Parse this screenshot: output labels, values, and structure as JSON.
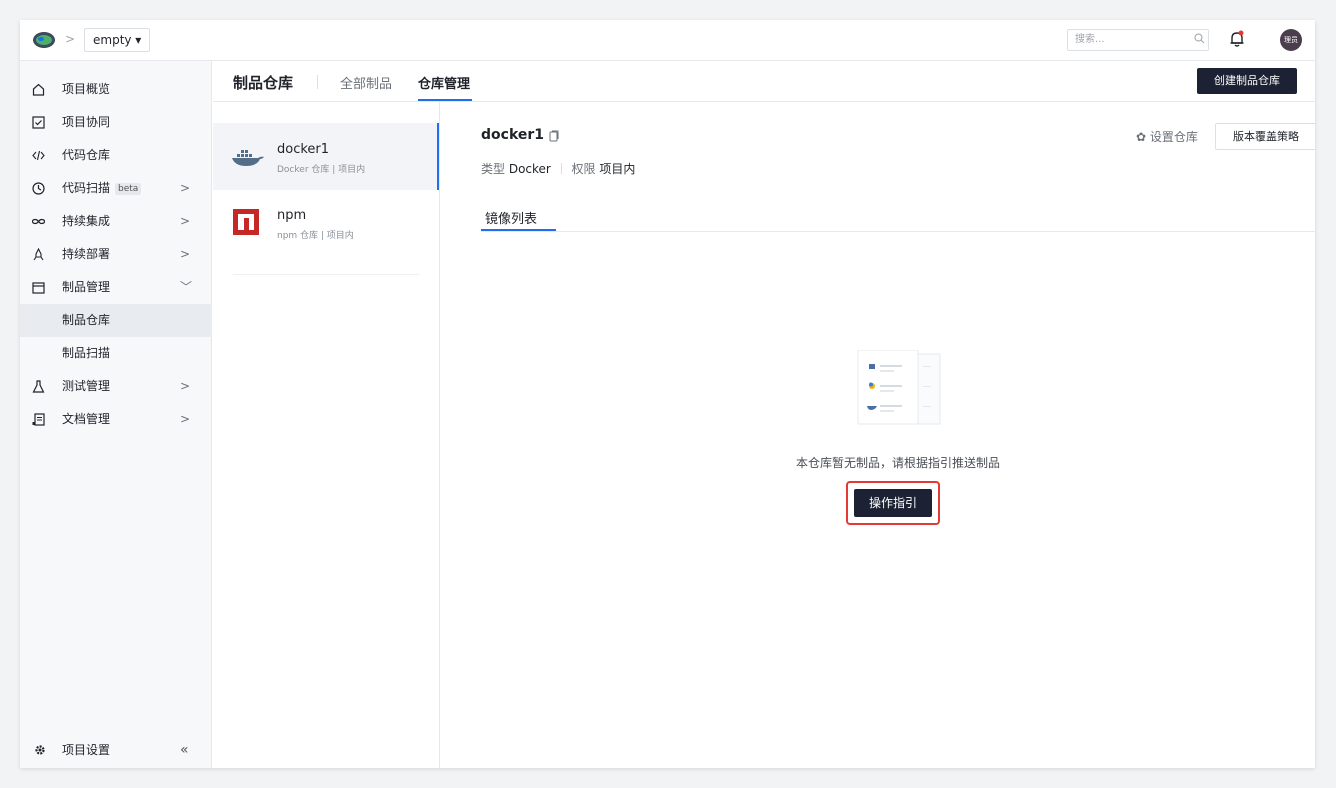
{
  "header": {
    "project_name": "empty ▾",
    "breadcrumb_separator": ">",
    "search_placeholder": "搜索...",
    "avatar_text": "理员"
  },
  "sidebar": {
    "items": [
      {
        "label": "项目概览",
        "icon": "home-icon"
      },
      {
        "label": "项目协同",
        "icon": "check-square-icon"
      },
      {
        "label": "代码仓库",
        "icon": "code-icon"
      },
      {
        "label": "代码扫描",
        "icon": "scan-icon",
        "badge": "beta",
        "arrow": ">"
      },
      {
        "label": "持续集成",
        "icon": "infinity-icon",
        "arrow": ">"
      },
      {
        "label": "持续部署",
        "icon": "rocket-icon",
        "arrow": ">"
      },
      {
        "label": "制品管理",
        "icon": "box-icon",
        "arrow": "﹀"
      },
      {
        "label": "制品仓库"
      },
      {
        "label": "制品扫描"
      },
      {
        "label": "测试管理",
        "icon": "flask-icon",
        "arrow": ">"
      },
      {
        "label": "文档管理",
        "icon": "doc-icon",
        "arrow": ">"
      }
    ],
    "footer_label": "项目设置",
    "collapse_glyph": "«"
  },
  "content_header": {
    "title": "制品仓库",
    "tab_all": "全部制品",
    "tab_manage": "仓库管理",
    "create_button": "创建制品仓库"
  },
  "repos": [
    {
      "name": "docker1",
      "meta": "Docker 仓库 | 项目内"
    },
    {
      "name": "npm",
      "meta": "npm 仓库 | 项目内"
    }
  ],
  "detail": {
    "title": "docker1",
    "type_label": "类型",
    "type_value": "Docker",
    "perm_label": "权限",
    "perm_value": "项目内",
    "settings_link": "设置仓库",
    "policy_button": "版本覆盖策略",
    "tab": "镜像列表",
    "empty_text": "本仓库暂无制品，请根据指引推送制品",
    "guide_button": "操作指引"
  },
  "colors": {
    "accent": "#1f6df0",
    "primary_button": "#1c2233",
    "highlight_border": "#e53935"
  }
}
